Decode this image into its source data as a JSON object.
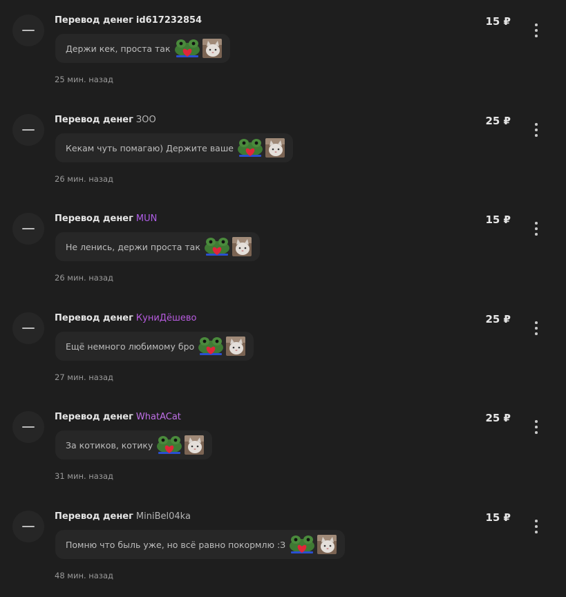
{
  "feed": {
    "items": [
      {
        "label": "Перевод денег",
        "sender": "id617232854",
        "sender_color": "#e6e6e6",
        "sender_bold": true,
        "message": "Держи кек, проста так",
        "amount": "15 ₽",
        "time": "25 мин. назад"
      },
      {
        "label": "Перевод денег",
        "sender": "ЗОО",
        "sender_color": "#b5b5b5",
        "sender_bold": false,
        "message": "Кекам чуть помагаю) Держите ваше",
        "amount": "25 ₽",
        "time": "26 мин. назад"
      },
      {
        "label": "Перевод денег",
        "sender": "MUN",
        "sender_color": "#b05ee8",
        "sender_bold": false,
        "message": "Не ленись, держи проста так",
        "amount": "15 ₽",
        "time": "26 мин. назад"
      },
      {
        "label": "Перевод денег",
        "sender": "КуниДёшево",
        "sender_color": "#b85ce0",
        "sender_bold": false,
        "message": "Ещё немного любимому бро",
        "amount": "25 ₽",
        "time": "27 мин. назад"
      },
      {
        "label": "Перевод денег",
        "sender": "WhatACat",
        "sender_color": "#c070e8",
        "sender_bold": false,
        "message": "За котиков, котику",
        "amount": "25 ₽",
        "time": "31 мин. назад"
      },
      {
        "label": "Перевод денег",
        "sender": "MiniBel04ka",
        "sender_color": "#b5b5b5",
        "sender_bold": false,
        "message": "Помню что быль уже, но всё равно покормлю :З",
        "amount": "15 ₽",
        "time": "48 мин. назад"
      }
    ]
  }
}
